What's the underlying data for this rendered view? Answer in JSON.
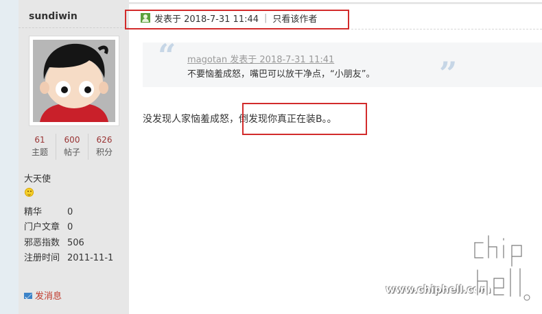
{
  "author": {
    "username": "sundiwin",
    "stats": [
      {
        "value": "61",
        "label": "主题"
      },
      {
        "value": "600",
        "label": "帖子"
      },
      {
        "value": "626",
        "label": "积分"
      }
    ],
    "rank": "大天使",
    "info": [
      {
        "key": "精华",
        "value": "0"
      },
      {
        "key": "门户文章",
        "value": "0"
      },
      {
        "key": "邪恶指数",
        "value": "506"
      },
      {
        "key": "注册时间",
        "value": "2011-11-1"
      }
    ],
    "send_message": "发消息"
  },
  "post": {
    "posted_at": "发表于 2018-7-31 11:44",
    "author_only": "只看该作者",
    "quote": {
      "meta": "magotan 发表于 2018-7-31 11:41",
      "text": "不要恼羞成怒，嘴巴可以放干净点，“小朋友”。"
    },
    "body_prefix": "没发现人家恼羞成怒，",
    "body_highlight": "倒发现你真正在装B。。"
  },
  "watermark": {
    "url": "www.chiphell.com",
    "logo": "chip hell"
  },
  "colors": {
    "sidebar_bg": "#e7e7e7",
    "quote_bg": "#f5f6f7",
    "annotation_red": "#d22a2a",
    "stat_number": "#993333",
    "link_red": "#c0392b"
  },
  "icons": [
    "online-user-icon",
    "smiley-icon",
    "mail-icon",
    "open-quote-icon",
    "close-quote-icon"
  ]
}
